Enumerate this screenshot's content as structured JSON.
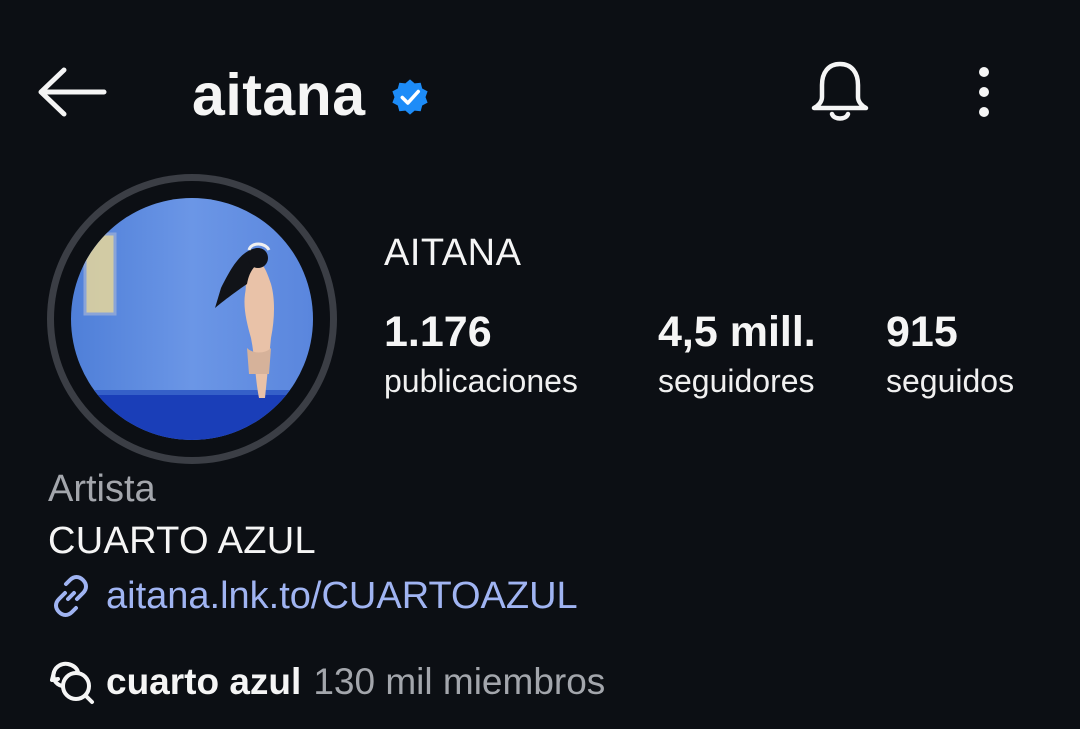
{
  "header": {
    "username": "aitana",
    "icons": [
      "back-arrow-icon",
      "verified-badge-icon",
      "notification-bell-icon",
      "more-options-icon"
    ]
  },
  "profile": {
    "display_name": "AITANA",
    "stats": [
      {
        "value": "1.176",
        "label": "publicaciones"
      },
      {
        "value": "4,5 mill.",
        "label": "seguidores"
      },
      {
        "value": "915",
        "label": "seguidos"
      }
    ],
    "category": "Artista",
    "bio": "CUARTO AZUL",
    "link": "aitana.lnk.to/CUARTOAZUL",
    "channel": {
      "name": "cuarto azul",
      "members": "130 mil miembros"
    }
  },
  "colors": {
    "background": "#0c0f14",
    "verified": "#1d8cf8",
    "link": "#a0b4f2",
    "secondary_text": "#a3a6ac"
  }
}
